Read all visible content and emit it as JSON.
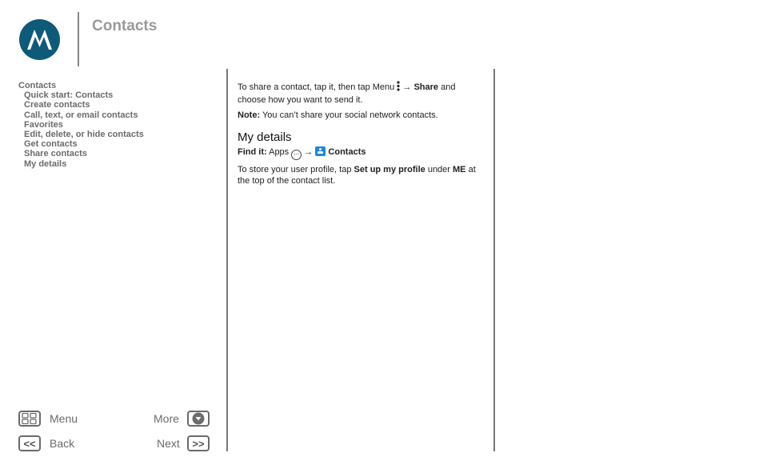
{
  "header": {
    "title": "Contacts"
  },
  "toc": {
    "heading": "Contacts",
    "items": [
      {
        "label": "Quick start: Contacts"
      },
      {
        "label": "Create contacts"
      },
      {
        "label": "Call, text, or email contacts"
      },
      {
        "label": "Favorites"
      },
      {
        "label": "Edit, delete, or hide contacts"
      },
      {
        "label": "Get contacts"
      },
      {
        "label": "Share contacts"
      },
      {
        "label": "My details"
      }
    ]
  },
  "main": {
    "share_p1_a": "To share a contact, tap it, then tap Menu ",
    "arrow": "→",
    "share_bold": "Share",
    "share_p1_b": " and choose how you want to send it.",
    "note_label": "Note:",
    "note_text": " You can’t share your social network contacts.",
    "section_title": "My details",
    "findit_label": "Find it:",
    "findit_apps": " Apps ",
    "findit_contacts": "Contacts",
    "apps_icon_glyph": "⋯",
    "profile_a": "To store your user profile, tap ",
    "profile_bold1": "Set up my profile",
    "profile_b": " under ",
    "profile_bold2": "ME",
    "profile_c": " at the top of the contact list."
  },
  "nav": {
    "menu_label": "Menu",
    "more_label": "More",
    "back_label": "Back",
    "next_label": "Next",
    "back_glyph": "<<",
    "next_glyph": ">>"
  }
}
